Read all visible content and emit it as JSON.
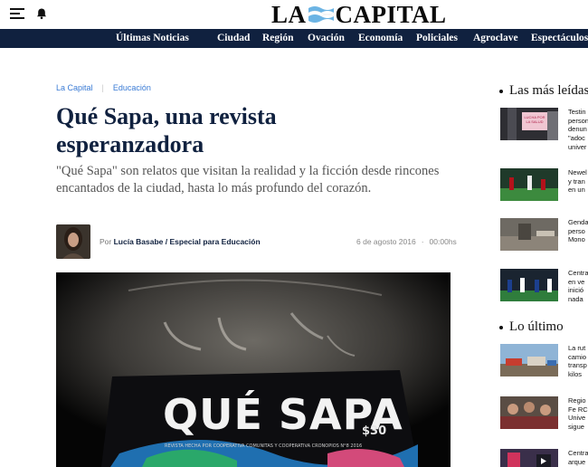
{
  "header": {
    "logo_text_left": "LA",
    "logo_text_right": "CAPITAL"
  },
  "nav": {
    "items": [
      "Últimas Noticias",
      "Ciudad",
      "Región",
      "Ovación",
      "Economía",
      "Policiales",
      "Agroclave",
      "Espectáculos"
    ]
  },
  "article": {
    "breadcrumb": [
      "La Capital",
      "Educación"
    ],
    "title": "Qué Sapa, una revista esperanzadora",
    "subtitle": "\"Qué Sapa\" son relatos que visitan la realidad y la ficción desde rincones encantados de la ciudad, hasta lo más profundo del corazón.",
    "byline_prefix": "Por",
    "author": "Lucía Basabe / Especial para Educación",
    "date": "6 de agosto 2016",
    "time_sep": "·",
    "time": "00:00hs",
    "hero": {
      "title": "QUÉ SAPA",
      "price": "$30",
      "tagline": "REVISTA HECHA POR COOPERATIVA COMUNITAS Y COOPERATIVA CRONOPIOS N°8 2016"
    }
  },
  "sidebar": {
    "most_read_title": "Las más leídas",
    "most_read": [
      {
        "lines": [
          "Testin",
          "person",
          "denun",
          "\"adoc",
          "univer"
        ],
        "thumb_text": "LUCHA POR LA SALUD"
      },
      {
        "lines": [
          "Newel",
          "y tran",
          "en un"
        ]
      },
      {
        "lines": [
          "Genda",
          "perso",
          "Mono"
        ]
      },
      {
        "lines": [
          "Centra",
          "en ve",
          "inició",
          "nada"
        ]
      }
    ],
    "latest_title": "Lo último",
    "latest": [
      {
        "lines": [
          "La rut",
          "camio",
          "transp",
          "kilos"
        ]
      },
      {
        "lines": [
          "Regio",
          "Fe RC",
          "Unive",
          "sigue"
        ]
      },
      {
        "lines": [
          "Centra",
          "arque"
        ]
      }
    ]
  },
  "colors": {
    "navy": "#10213f",
    "link_blue": "#3a7bd5",
    "flag_blue": "#6cb4e4"
  }
}
